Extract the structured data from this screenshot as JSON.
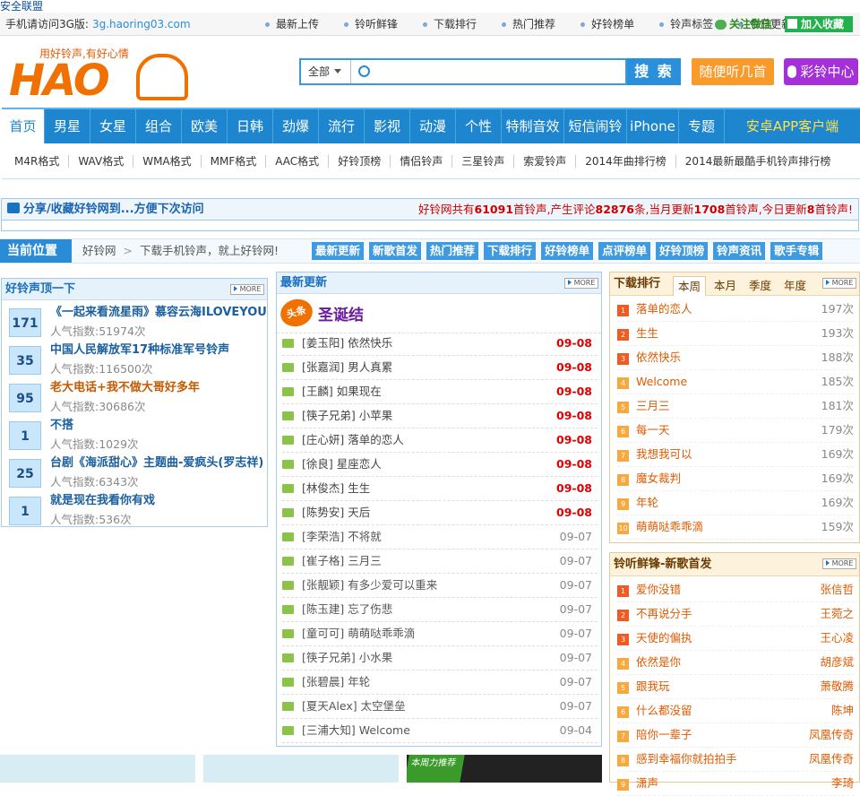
{
  "top_link": "安全联盟",
  "topbar": {
    "mobile_label": "手机请访问3G版:",
    "mobile_url": "3g.haoring03.com",
    "nav": [
      "最新上传",
      "铃听鲜锋",
      "下载排行",
      "热门推荐",
      "好铃榜单",
      "铃声标签",
      "今日更新"
    ],
    "wechat": "关注微信",
    "favorite": "加入收藏"
  },
  "logo": {
    "tagline": "用好铃声,有好心情",
    "text": "HAO"
  },
  "search": {
    "category": "全部",
    "button": "搜 索",
    "random": "随便听几首",
    "color_ring": "彩铃中心"
  },
  "main_nav": [
    "首页",
    "男星",
    "女星",
    "组合",
    "欧美",
    "日韩",
    "劲爆",
    "流行",
    "影视",
    "动漫",
    "个性",
    "特制音效",
    "短信闹铃",
    "iPhone",
    "专题",
    "安卓APP客户端"
  ],
  "sub_nav": [
    "M4R格式",
    "WAV格式",
    "WMA格式",
    "MMF格式",
    "AAC格式",
    "好铃顶榜",
    "情侣铃声",
    "三星铃声",
    "索爱铃声",
    "2014年曲排行榜",
    "2014最新最酷手机铃声排行榜"
  ],
  "notice": {
    "left": "分享/收藏好铃网到...方便下次访问",
    "r1": "好铃网共有",
    "total": "61091",
    "r2": "首铃声,产生评论",
    "comments": "82876",
    "r3": "条,当月更新",
    "month": "1708",
    "r4": "首铃声,今日更新",
    "today": "8",
    "r5": "首铃声!"
  },
  "position": {
    "label": "当前位置",
    "home": "好铃网",
    "sep": ">",
    "current": "下载手机铃声，就上好铃网!",
    "quick": [
      "最新更新",
      "新歌首发",
      "热门推荐",
      "下载排行",
      "好铃榜单",
      "点评榜单",
      "好铃顶榜",
      "铃声资讯",
      "歌手专辑"
    ]
  },
  "more_label": "MORE",
  "hot_panel": {
    "title": "好铃声顶一下",
    "items": [
      {
        "num": "171",
        "title": "《一起来看流星雨》慕容云海ILOVEYOU",
        "pop": "人气指数:51974次",
        "color": "#1a5f9e"
      },
      {
        "num": "35",
        "title": "中国人民解放军17种标准军号铃声",
        "pop": "人气指数:116500次",
        "color": "#1a5f9e"
      },
      {
        "num": "95",
        "title": "老大电话+我不做大哥好多年",
        "pop": "人气指数:30686次",
        "color": "#c55a00"
      },
      {
        "num": "1",
        "title": "不搭",
        "pop": "人气指数:1029次",
        "color": "#1a5f9e"
      },
      {
        "num": "25",
        "title": "台剧《海派甜心》主题曲-爱疯头(罗志祥)",
        "pop": "人气指数:6343次",
        "color": "#1a5f9e"
      },
      {
        "num": "1",
        "title": "就是现在我看你有戏",
        "pop": "人气指数:536次",
        "color": "#1a5f9e"
      }
    ]
  },
  "new_panel": {
    "title": "最新更新",
    "badge": "头条",
    "headline": "圣诞结",
    "items": [
      {
        "title": "[姜玉阳] 依然快乐",
        "date": "09-08",
        "hot": true
      },
      {
        "title": "[张嘉润] 男人真累",
        "date": "09-08",
        "hot": true
      },
      {
        "title": "[王麟] 如果现在",
        "date": "09-08",
        "hot": true
      },
      {
        "title": "[筷子兄弟] 小苹果",
        "date": "09-08",
        "hot": true
      },
      {
        "title": "[庄心妍] 落单的恋人",
        "date": "09-08",
        "hot": true
      },
      {
        "title": "[徐良] 星座恋人",
        "date": "09-08",
        "hot": true
      },
      {
        "title": "[林俊杰] 生生",
        "date": "09-08",
        "hot": true
      },
      {
        "title": "[陈势安] 天后",
        "date": "09-08",
        "hot": true
      },
      {
        "title": "[李荣浩] 不将就",
        "date": "09-07",
        "hot": false
      },
      {
        "title": "[崔子格] 三月三",
        "date": "09-07",
        "hot": false
      },
      {
        "title": "[张靓颖] 有多少爱可以重来",
        "date": "09-07",
        "hot": false
      },
      {
        "title": "[陈玉建] 忘了伤悲",
        "date": "09-07",
        "hot": false
      },
      {
        "title": "[童可可] 萌萌哒乖乖滴",
        "date": "09-07",
        "hot": false
      },
      {
        "title": "[筷子兄弟] 小水果",
        "date": "09-07",
        "hot": false
      },
      {
        "title": "[张碧晨] 年轮",
        "date": "09-07",
        "hot": false
      },
      {
        "title": "[夏天Alex] 太空堡垒",
        "date": "09-07",
        "hot": false
      },
      {
        "title": "[三浦大知] Welcome",
        "date": "09-04",
        "hot": false
      }
    ]
  },
  "rank_panel": {
    "title": "下载排行",
    "tabs": [
      "本周",
      "本月",
      "季度",
      "年度"
    ],
    "items": [
      {
        "n": "1",
        "title": "落单的恋人",
        "count": "197次"
      },
      {
        "n": "2",
        "title": "生生",
        "count": "193次"
      },
      {
        "n": "3",
        "title": "依然快乐",
        "count": "188次"
      },
      {
        "n": "4",
        "title": "Welcome",
        "count": "185次"
      },
      {
        "n": "5",
        "title": "三月三",
        "count": "181次"
      },
      {
        "n": "6",
        "title": "每一天",
        "count": "179次"
      },
      {
        "n": "7",
        "title": "我想我可以",
        "count": "169次"
      },
      {
        "n": "8",
        "title": "魔女裁判",
        "count": "169次"
      },
      {
        "n": "9",
        "title": "年轮",
        "count": "169次"
      },
      {
        "n": "10",
        "title": "萌萌哒乖乖滴",
        "count": "159次"
      }
    ]
  },
  "fresh_panel": {
    "title": "铃听鲜锋-新歌首发",
    "items": [
      {
        "n": "1",
        "title": "爱你没错",
        "artist": "张信哲"
      },
      {
        "n": "2",
        "title": "不再说分手",
        "artist": "王菀之"
      },
      {
        "n": "3",
        "title": "天使的偏执",
        "artist": "王心凌"
      },
      {
        "n": "4",
        "title": "依然是你",
        "artist": "胡彦斌"
      },
      {
        "n": "5",
        "title": "跟我玩",
        "artist": "萧敬腾"
      },
      {
        "n": "6",
        "title": "什么都没留",
        "artist": "陈坤"
      },
      {
        "n": "7",
        "title": "陪你一辈子",
        "artist": "凤凰传奇"
      },
      {
        "n": "8",
        "title": "感到幸福你就拍拍手",
        "artist": "凤凰传奇"
      },
      {
        "n": "9",
        "title": "潇声",
        "artist": "李琦"
      }
    ]
  },
  "banner": {
    "badge": "本周力推荐"
  },
  "colors": {
    "accent": "#1d86cf",
    "orange": "#f07000",
    "red_date": "#e00000"
  }
}
